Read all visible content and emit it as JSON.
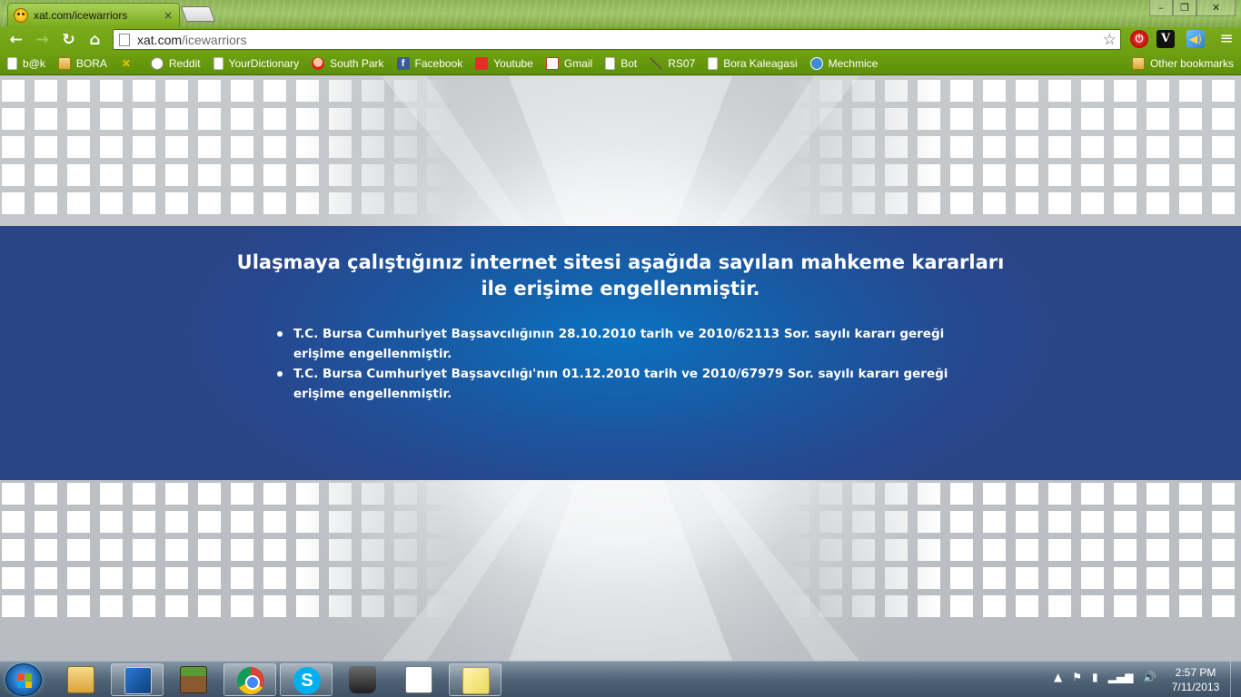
{
  "browser": {
    "tab": {
      "title": "xat.com/icewarriors",
      "close_glyph": "×"
    },
    "window_controls": {
      "minimize": "–",
      "maximize": "❐",
      "close": "✕"
    },
    "toolbar": {
      "back": "←",
      "forward": "→",
      "reload": "↻",
      "home": "⌂",
      "url_host": "xat.com",
      "url_path": "/icewarriors",
      "star": "☆",
      "ext_red": "⏻",
      "ext_v": "V",
      "ext_sp": "◀)",
      "menu": "≡"
    },
    "bookmarks": [
      {
        "label": "b@k",
        "icon": "page-icon"
      },
      {
        "label": "BORA",
        "icon": "folder-icon"
      },
      {
        "label": "",
        "icon": "xat-icon"
      },
      {
        "label": "Reddit",
        "icon": "reddit-icon"
      },
      {
        "label": "YourDictionary",
        "icon": "page-icon"
      },
      {
        "label": "South Park",
        "icon": "south-park-icon"
      },
      {
        "label": "Facebook",
        "icon": "facebook-icon"
      },
      {
        "label": "Youtube",
        "icon": "youtube-icon"
      },
      {
        "label": "Gmail",
        "icon": "gmail-icon"
      },
      {
        "label": "Bot",
        "icon": "page-icon"
      },
      {
        "label": "RS07",
        "icon": "sword-icon"
      },
      {
        "label": "Bora Kaleagasi",
        "icon": "page-icon"
      },
      {
        "label": "Mechmice",
        "icon": "mechmice-icon"
      }
    ],
    "other_bookmarks": "Other bookmarks"
  },
  "page": {
    "heading_line1": "Ulaşmaya çalıştığınız internet sitesi aşağıda sayılan mahkeme kararları",
    "heading_line2": "ile erişime engellenmiştir.",
    "items": [
      "T.C. Bursa Cumhuriyet Başsavcılığının 28.10.2010 tarih ve 2010/62113 Sor. sayılı kararı gereği erişime engellenmiştir.",
      "T.C. Bursa Cumhuriyet Başsavcılığı'nın 01.12.2010 tarih ve 2010/67979 Sor. sayılı kararı gereği erişime engellenmiştir."
    ],
    "colors": {
      "banner": "#1a57a0",
      "banner_center": "#0a72c0",
      "background": "#c7cacd"
    }
  },
  "taskbar": {
    "apps": [
      {
        "name": "windows-explorer-icon"
      },
      {
        "name": "pencil-app-icon"
      },
      {
        "name": "minecraft-icon"
      },
      {
        "name": "chrome-icon",
        "active": true
      },
      {
        "name": "skype-icon",
        "glyph": "S"
      },
      {
        "name": "hat-app-icon"
      },
      {
        "name": "notepad-icon"
      },
      {
        "name": "sticky-notes-icon"
      }
    ],
    "tray": {
      "up_arrow": "▲",
      "flag": "⚑",
      "battery": "▮",
      "signal": "▂▄▆",
      "volume": "🔊"
    },
    "clock_time": "2:57 PM",
    "clock_date": "7/11/2013"
  }
}
